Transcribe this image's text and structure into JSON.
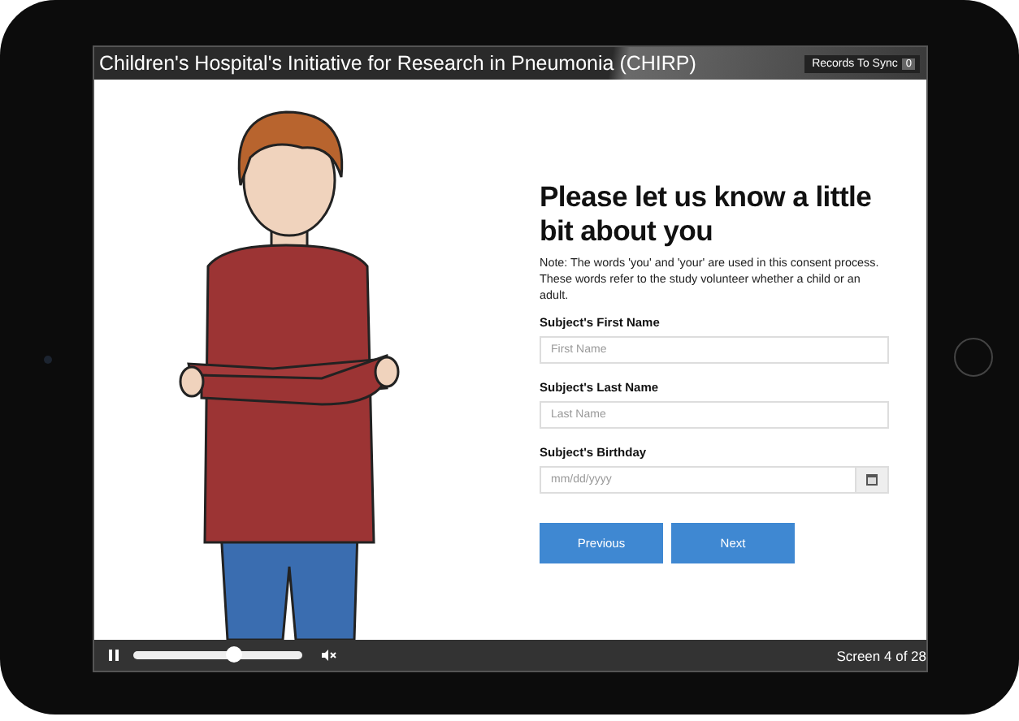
{
  "header": {
    "title": "Children's Hospital's Initiative for Research in Pneumonia (CHIRP)",
    "sync_label": "Records To Sync",
    "sync_count": "0"
  },
  "form": {
    "heading": "Please let us know a little bit about you",
    "note": "Note: The words 'you' and 'your' are used in this consent process. These words refer to the study volunteer whether a child or an adult.",
    "fields": [
      {
        "kind": "text",
        "label": "Subject's First Name",
        "placeholder": "First Name"
      },
      {
        "kind": "text",
        "label": "Subject's Last Name",
        "placeholder": "Last Name"
      },
      {
        "kind": "date",
        "label": "Subject's Birthday",
        "placeholder": "mm/dd/yyyy"
      }
    ],
    "buttons": [
      "Previous",
      "Next"
    ]
  },
  "player": {
    "playing": true,
    "level": 0.6,
    "muted": true,
    "screen_counter": "Screen 4 of 28"
  }
}
